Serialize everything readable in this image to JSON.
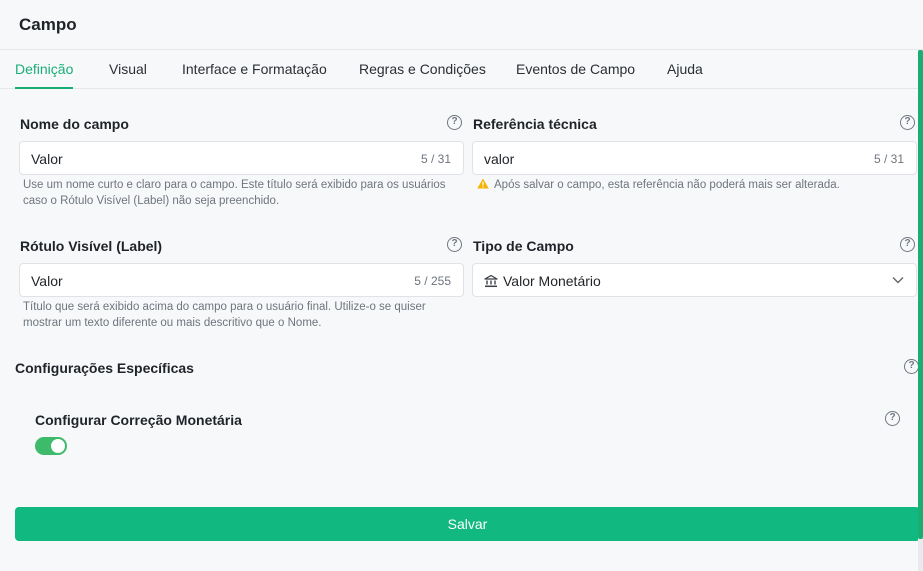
{
  "header": {
    "title": "Campo"
  },
  "tabs": [
    {
      "label": "Definição"
    },
    {
      "label": "Visual"
    },
    {
      "label": "Interface e Formatação"
    },
    {
      "label": "Regras e Condições"
    },
    {
      "label": "Eventos de Campo"
    },
    {
      "label": "Ajuda"
    }
  ],
  "active_tab": "Definição",
  "fields": {
    "nome": {
      "label": "Nome do campo",
      "value": "Valor",
      "counter": "5 / 31",
      "hint": "Use um nome curto e claro para o campo. Este título será exibido para os usuários caso o Rótulo Visível (Label) não seja preenchido."
    },
    "referencia": {
      "label": "Referência técnica",
      "value": "valor",
      "counter": "5 / 31",
      "hint": "Após salvar o campo, esta referência não poderá mais ser alterada."
    },
    "rotulo": {
      "label": "Rótulo Visível (Label)",
      "value": "Valor",
      "counter": "5 / 255",
      "hint": "Título que será exibido acima do campo para o usuário final. Utilize-o se quiser mostrar um texto diferente ou mais descritivo que o Nome."
    },
    "tipo": {
      "label": "Tipo de Campo",
      "value": "Valor Monetário",
      "icon": "bank-icon"
    }
  },
  "specific": {
    "title": "Configurações Específicas",
    "correcao_label": "Configurar Correção Monetária",
    "correcao_enabled": true
  },
  "actions": {
    "save_label": "Salvar"
  },
  "help_glyph": "?",
  "colors": {
    "accent": "#1aae75",
    "save_button": "#11b981",
    "toggle_on": "#3dbb6a",
    "warning": "#f5b300"
  }
}
